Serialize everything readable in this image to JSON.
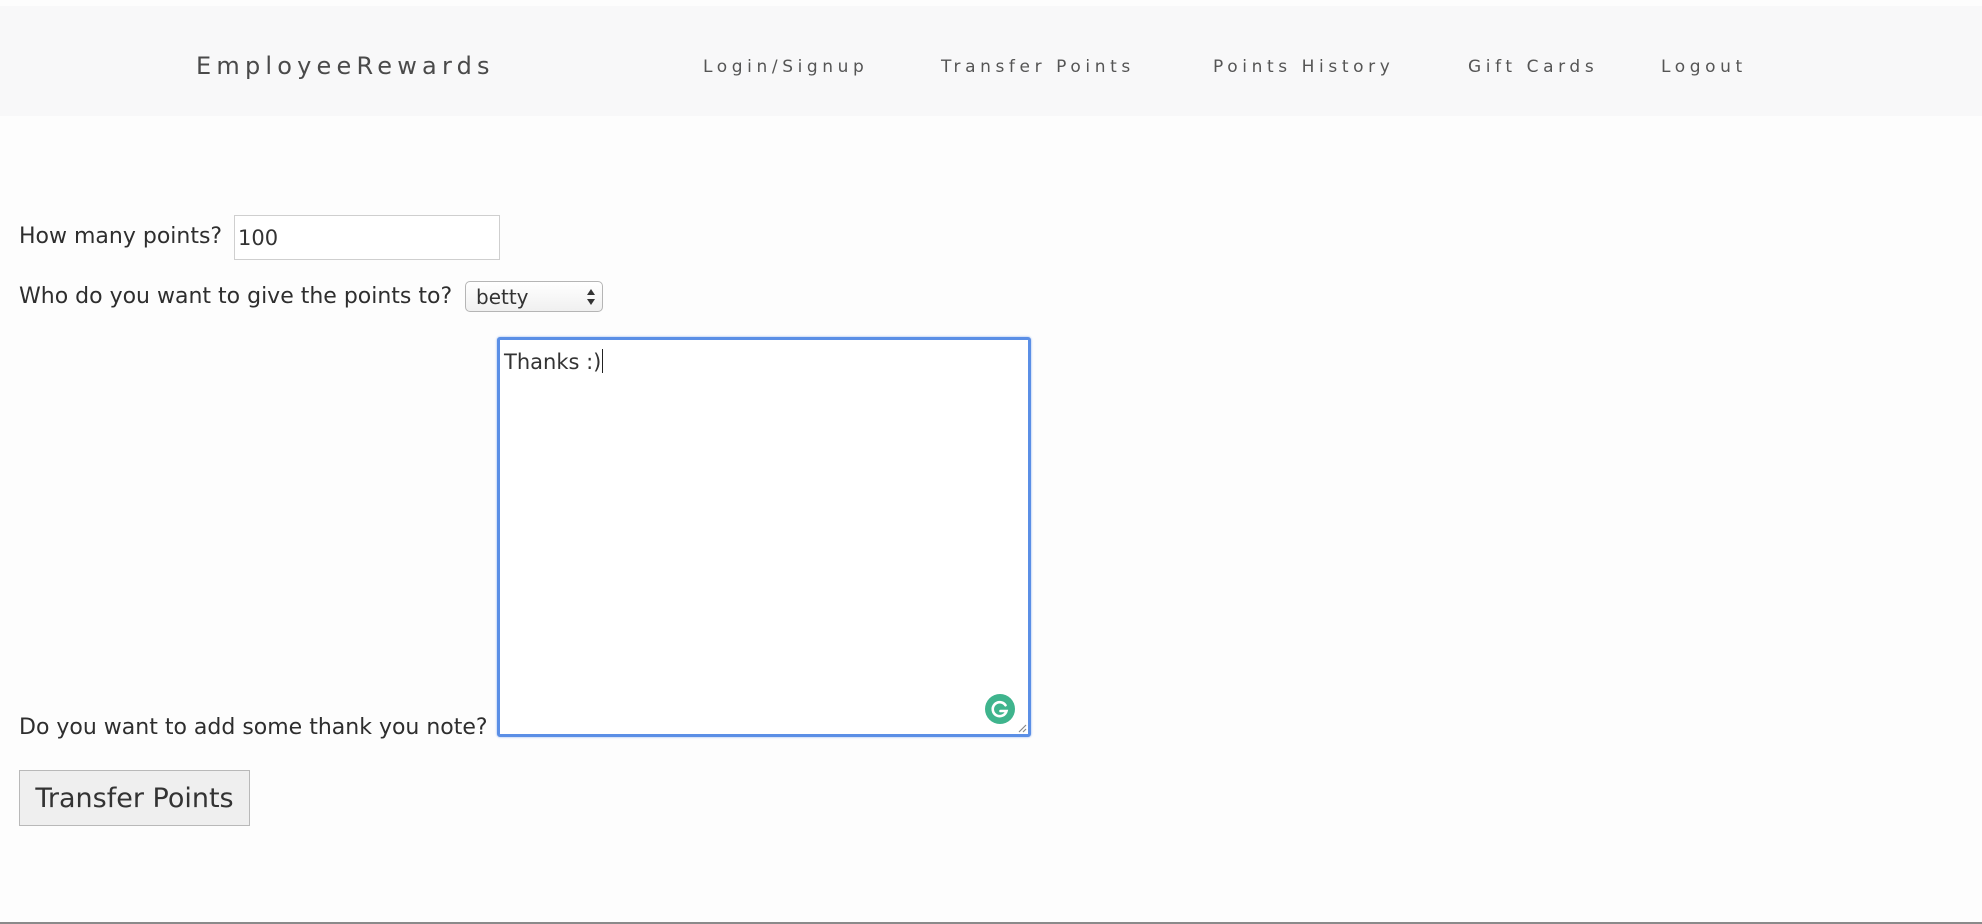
{
  "navbar": {
    "brand": "EmployeeRewards",
    "links": [
      {
        "label": "Login/Signup"
      },
      {
        "label": "Transfer Points"
      },
      {
        "label": "Points History"
      },
      {
        "label": "Gift Cards"
      },
      {
        "label": "Logout"
      }
    ]
  },
  "form": {
    "points_label": "How many points?",
    "points_value": "100",
    "recipient_label": "Who do you want to give the points to?",
    "recipient_selected": "betty",
    "note_label": "Do you want to add some thank you note?",
    "note_value": "Thanks :)",
    "submit_label": "Transfer Points"
  },
  "colors": {
    "focus_border": "#5b8fe6",
    "grammarly": "#3fb48d",
    "navbar_bg": "#f8f8f9"
  },
  "icons": {
    "textarea_assistant": "grammarly-icon",
    "select_arrows": "select-arrows-icon",
    "resize": "resize-handle-icon"
  }
}
